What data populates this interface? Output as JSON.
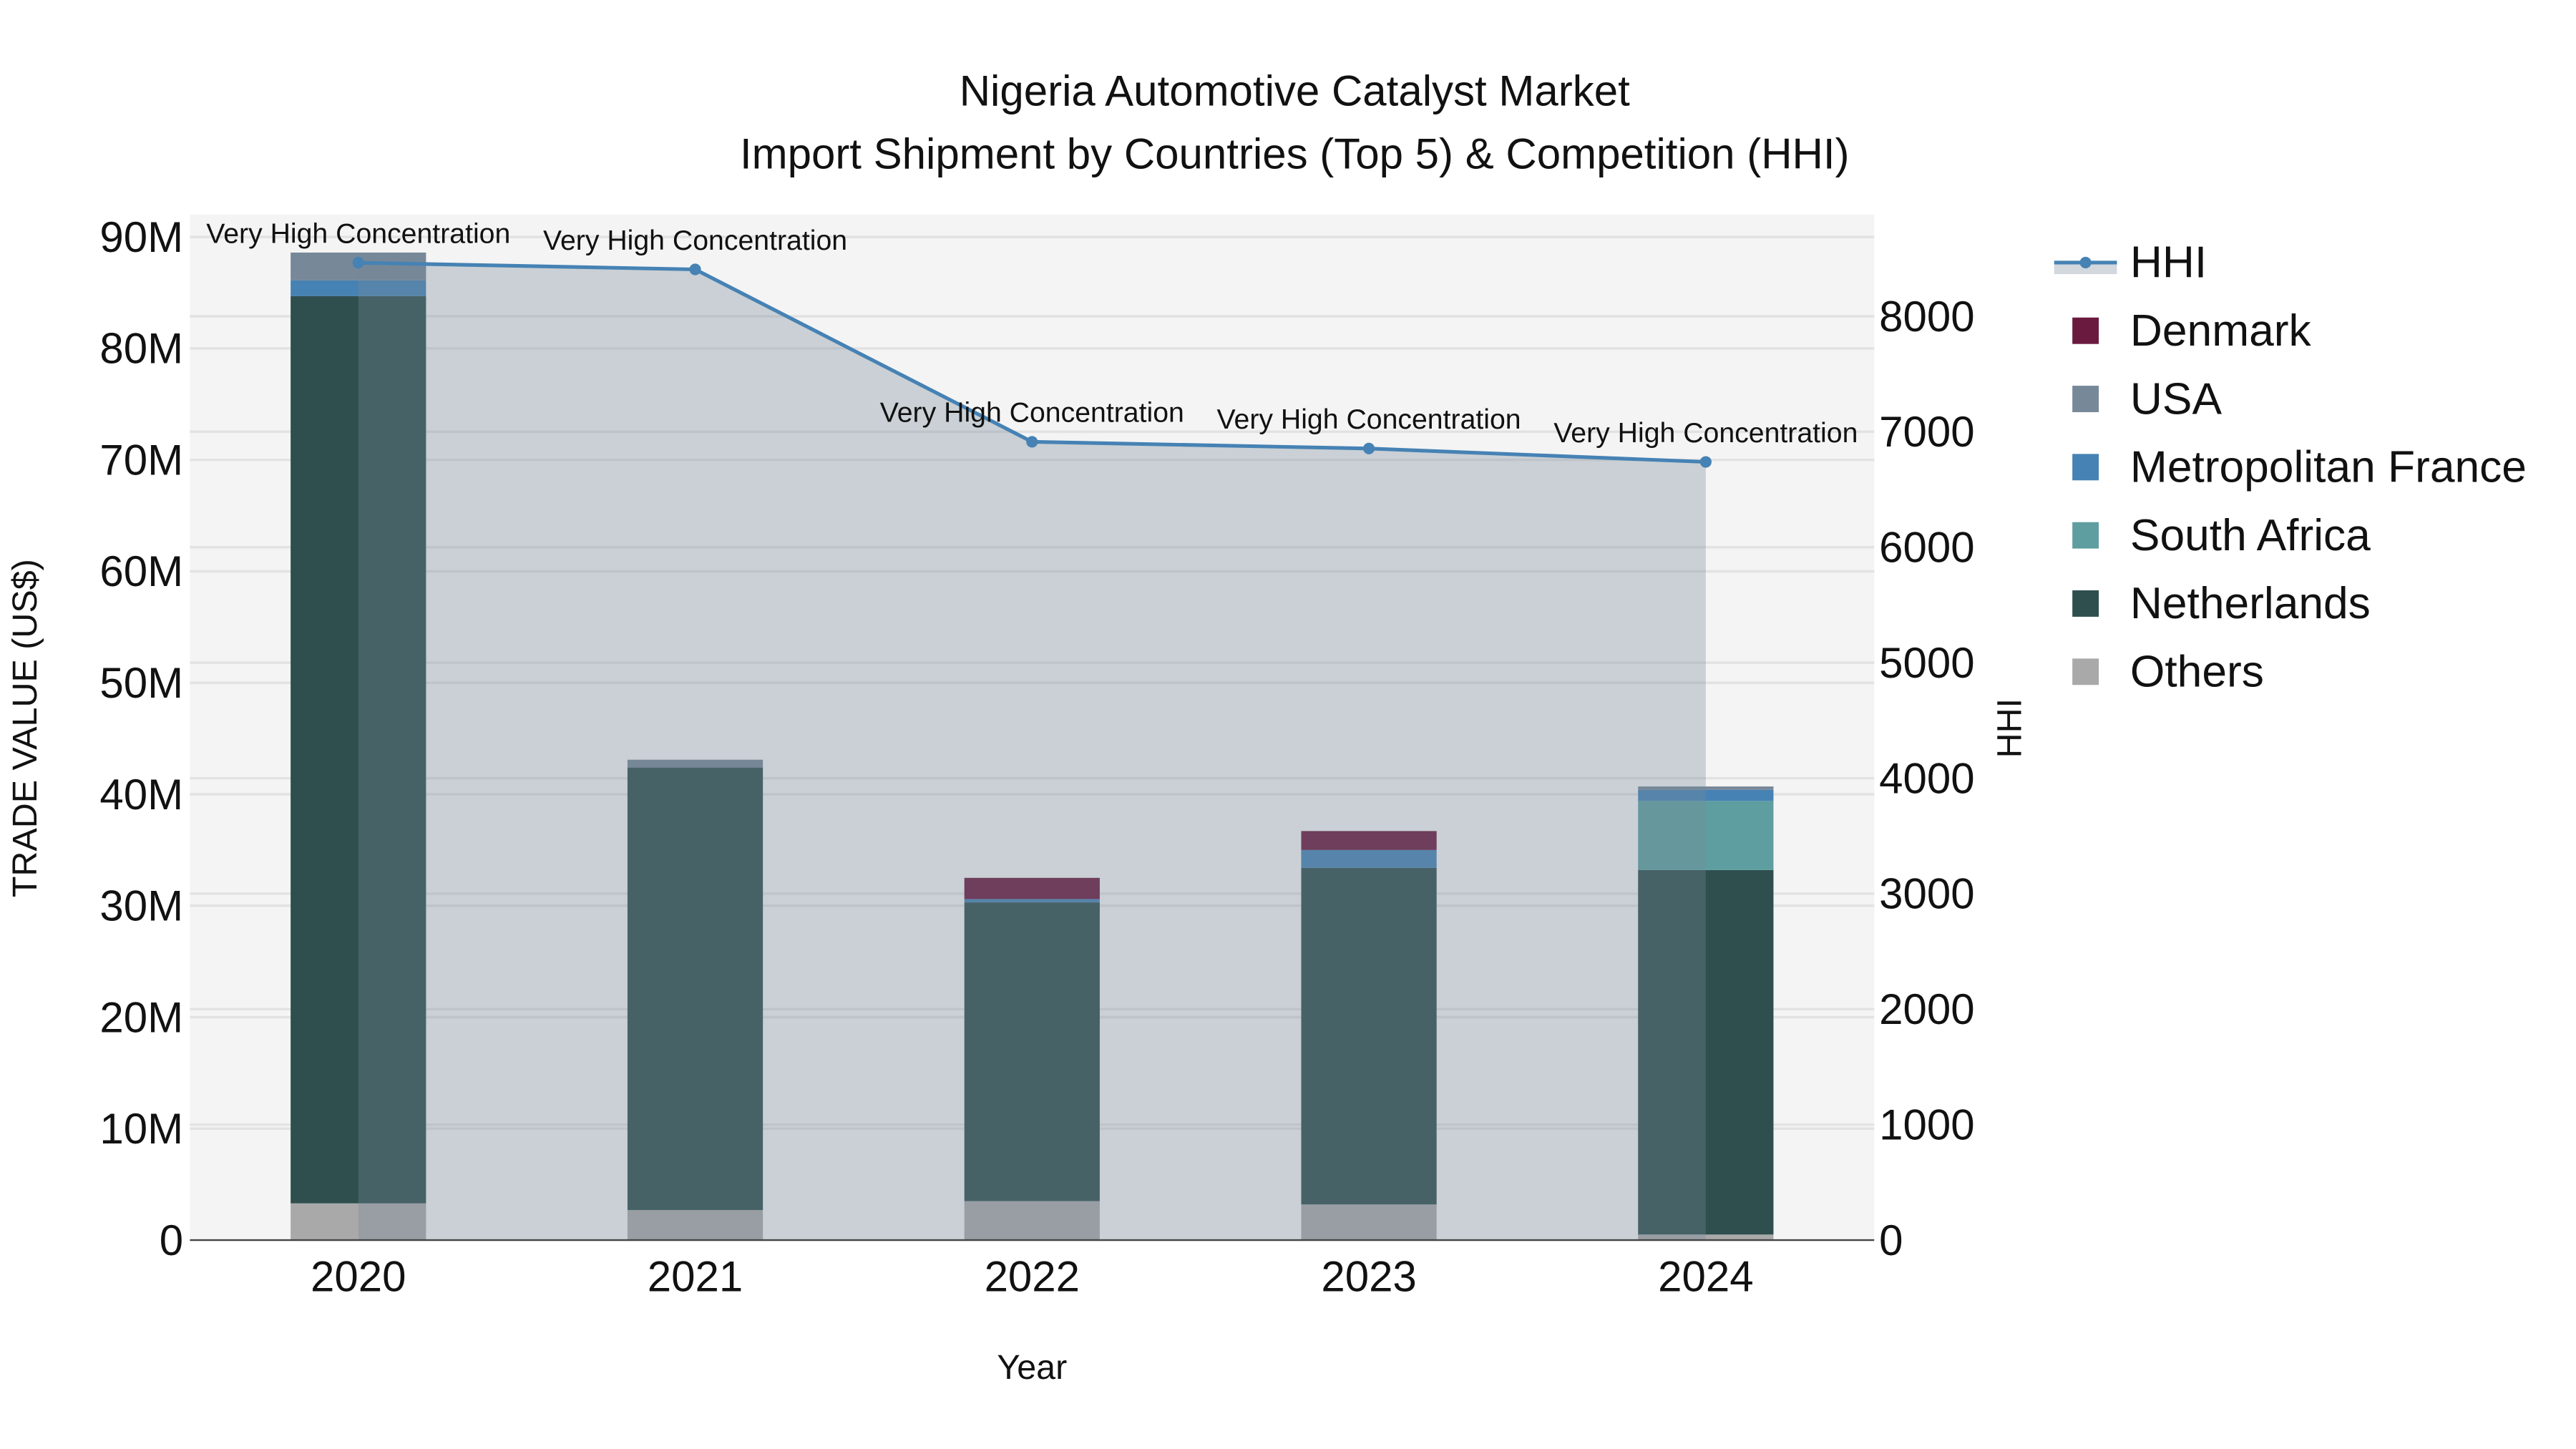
{
  "chart_data": {
    "type": "bar",
    "title_line1": "Nigeria Automotive Catalyst Market",
    "title_line2": "Import Shipment by Countries (Top 5) & Competition (HHI)",
    "xlabel": "Year",
    "ylabel": "TRADE VALUE (US$)",
    "y2label": "HHI",
    "ylim": [
      0,
      92
    ],
    "y2lim": [
      0,
      8880
    ],
    "yticks": [
      0,
      10,
      20,
      30,
      40,
      50,
      60,
      70,
      80,
      90
    ],
    "ytick_labels": [
      "0",
      "10M",
      "20M",
      "30M",
      "40M",
      "50M",
      "60M",
      "70M",
      "80M",
      "90M"
    ],
    "y2ticks": [
      0,
      1000,
      2000,
      3000,
      4000,
      5000,
      6000,
      7000,
      8000
    ],
    "y2tick_labels": [
      "0",
      "1000",
      "2000",
      "3000",
      "4000",
      "5000",
      "6000",
      "7000",
      "8000"
    ],
    "grid": true,
    "legend_position": "right",
    "categories": [
      "2020",
      "2021",
      "2022",
      "2023",
      "2024"
    ],
    "units": "million US$",
    "series": [
      {
        "name": "Others",
        "color": "#a9a9a9",
        "values": [
          3.3,
          2.7,
          3.5,
          3.2,
          0.5
        ]
      },
      {
        "name": "Netherlands",
        "color": "#2f4f4f",
        "values": [
          81.4,
          39.7,
          26.8,
          30.2,
          32.7
        ]
      },
      {
        "name": "South Africa",
        "color": "#5f9ea0",
        "values": [
          0,
          0,
          0,
          0,
          6.2
        ]
      },
      {
        "name": "Metropolitan France",
        "color": "#4682b4",
        "values": [
          1.4,
          0,
          0.3,
          1.6,
          1.0
        ]
      },
      {
        "name": "USA",
        "color": "#778899",
        "values": [
          2.5,
          0.7,
          0,
          0,
          0.3
        ]
      },
      {
        "name": "Denmark",
        "color": "#6b1a3f",
        "values": [
          0,
          0,
          1.9,
          1.7,
          0
        ]
      }
    ],
    "legend_order": [
      "HHI",
      "Denmark",
      "USA",
      "Metropolitan France",
      "South Africa",
      "Netherlands",
      "Others"
    ],
    "hhi": {
      "name": "HHI",
      "color": "#4682b4",
      "values": [
        8464,
        8406,
        6913,
        6855,
        6739
      ],
      "labels": [
        "Very High Concentration",
        "Very High Concentration",
        "Very High Concentration",
        "Very High Concentration",
        "Very High Concentration"
      ]
    }
  }
}
